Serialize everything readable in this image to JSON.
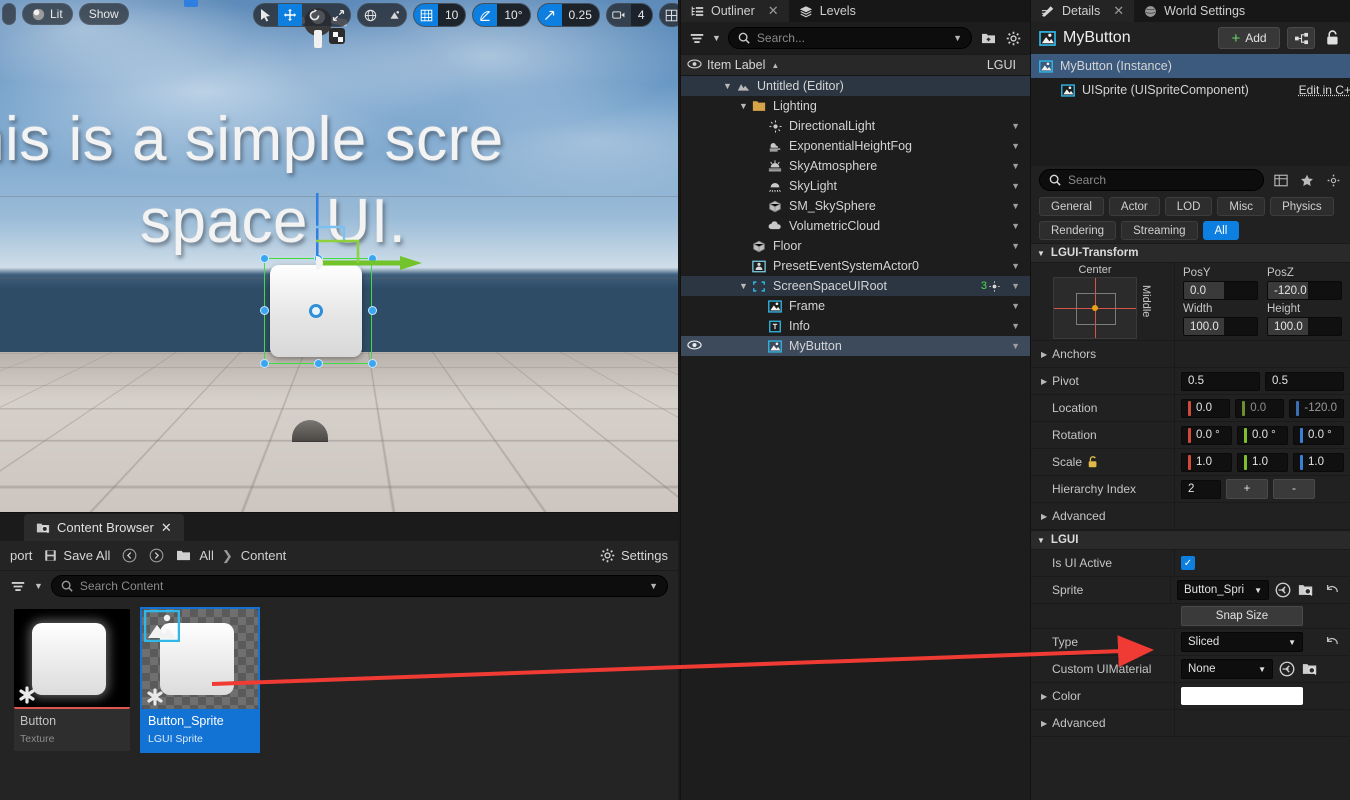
{
  "viewport": {
    "text_line1": "his is a simple scre",
    "text_line2": "space UI.",
    "view_mode": "Lit",
    "show_menu": "Show",
    "grid_snap_value": "10",
    "angle_snap_value": "10°",
    "scale_snap_value": "0.25",
    "camera_speed_value": "4",
    "icons": {
      "select": "cursor-icon",
      "translate": "move-icon",
      "rotate": "rotate-icon",
      "scale": "scale-icon",
      "world": "globe-icon",
      "surface_snap": "surface-snap-icon",
      "grid": "grid-icon",
      "angle": "angle-icon",
      "scale_snap": "scale-snap-icon",
      "camera": "camera-icon",
      "layout": "layout-icon"
    }
  },
  "content_browser": {
    "tab_label": "Content Browser",
    "import_label": "port",
    "save_all_label": "Save All",
    "breadcrumb_root": "All",
    "breadcrumb_current": "Content",
    "settings_label": "Settings",
    "search_placeholder": "Search Content",
    "assets": [
      {
        "name": "Button",
        "type": "Texture",
        "selected": false
      },
      {
        "name": "Button_Sprite",
        "type": "LGUI Sprite",
        "selected": true
      }
    ]
  },
  "outliner": {
    "tabs": [
      {
        "label": "Outliner",
        "icon": "outliner-icon",
        "active": true,
        "closable": true
      },
      {
        "label": "Levels",
        "icon": "levels-icon",
        "active": false,
        "closable": false
      }
    ],
    "search_placeholder": "Search...",
    "column_item_label": "Item Label",
    "column_sort": "▲",
    "column_type": "LGUI",
    "items": [
      {
        "label": "Untitled (Editor)",
        "indent": 1,
        "caret": "down",
        "icon": "world-icon",
        "state": "hl",
        "eye": false,
        "dropdown": false
      },
      {
        "label": "Lighting",
        "indent": 2,
        "caret": "down",
        "icon": "folder-icon",
        "state": "",
        "eye": false,
        "dropdown": false
      },
      {
        "label": "DirectionalLight",
        "indent": 3,
        "caret": "none",
        "icon": "light-icon",
        "state": "",
        "eye": false,
        "dropdown": true
      },
      {
        "label": "ExponentialHeightFog",
        "indent": 3,
        "caret": "none",
        "icon": "fog-icon",
        "state": "",
        "eye": false,
        "dropdown": true
      },
      {
        "label": "SkyAtmosphere",
        "indent": 3,
        "caret": "none",
        "icon": "atmosphere-icon",
        "state": "",
        "eye": false,
        "dropdown": true
      },
      {
        "label": "SkyLight",
        "indent": 3,
        "caret": "none",
        "icon": "skylight-icon",
        "state": "",
        "eye": false,
        "dropdown": true
      },
      {
        "label": "SM_SkySphere",
        "indent": 3,
        "caret": "none",
        "icon": "mesh-icon",
        "state": "",
        "eye": false,
        "dropdown": true
      },
      {
        "label": "VolumetricCloud",
        "indent": 3,
        "caret": "none",
        "icon": "cloud-icon",
        "state": "",
        "eye": false,
        "dropdown": true
      },
      {
        "label": "Floor",
        "indent": 2,
        "caret": "none",
        "icon": "mesh-icon",
        "state": "",
        "eye": false,
        "dropdown": true
      },
      {
        "label": "PresetEventSystemActor0",
        "indent": 2,
        "caret": "none",
        "icon": "event-icon",
        "state": "",
        "eye": false,
        "dropdown": true
      },
      {
        "label": "ScreenSpaceUIRoot",
        "indent": 2,
        "caret": "down",
        "icon": "uiroot-icon",
        "state": "hl",
        "eye": false,
        "dropdown": true,
        "badge": "3"
      },
      {
        "label": "Frame",
        "indent": 3,
        "caret": "none",
        "icon": "sprite-icon",
        "state": "",
        "eye": false,
        "dropdown": true
      },
      {
        "label": "Info",
        "indent": 3,
        "caret": "none",
        "icon": "text-icon",
        "state": "",
        "eye": false,
        "dropdown": true
      },
      {
        "label": "MyButton",
        "indent": 3,
        "caret": "none",
        "icon": "sprite-icon",
        "state": "sel",
        "eye": true,
        "dropdown": true
      }
    ]
  },
  "details": {
    "tabs": [
      {
        "label": "Details",
        "icon": "details-icon",
        "active": true,
        "closable": true
      },
      {
        "label": "World Settings",
        "icon": "globe-icon",
        "active": false,
        "closable": false
      }
    ],
    "object_name": "MyButton",
    "add_button": "Add",
    "blueprint_icon": "blueprint-icon",
    "lock_icon": "lock-icon",
    "components": [
      {
        "label": "MyButton (Instance)",
        "indent": 0,
        "selected": true,
        "icon": "sprite-icon"
      },
      {
        "label": "UISprite (UISpriteComponent)",
        "indent": 1,
        "selected": false,
        "icon": "sprite-icon",
        "link": "Edit in C++"
      }
    ],
    "search_placeholder": "Search",
    "filters": [
      "General",
      "Actor",
      "LOD",
      "Misc",
      "Physics",
      "Rendering",
      "Streaming",
      "All"
    ],
    "active_filter": "All",
    "transform": {
      "section_title": "LGUI-Transform",
      "anchor_h_label": "Center",
      "anchor_v_label": "Middle",
      "fields": [
        {
          "label": "PosY",
          "value": "0.0"
        },
        {
          "label": "PosZ",
          "value": "-120.0"
        },
        {
          "label": "Width",
          "value": "100.0"
        },
        {
          "label": "Height",
          "value": "100.0"
        }
      ],
      "anchors_label": "Anchors",
      "pivot_label": "Pivot",
      "pivot": [
        "0.5",
        "0.5"
      ],
      "location_label": "Location",
      "location": [
        "0.0",
        "0.0",
        "-120.0"
      ],
      "rotation_label": "Rotation",
      "rotation": [
        "0.0 °",
        "0.0 °",
        "0.0 °"
      ],
      "scale_label": "Scale",
      "scale": [
        "1.0",
        "1.0",
        "1.0"
      ],
      "scale_lock_icon": "unlock-icon",
      "hierarchy_index_label": "Hierarchy Index",
      "hierarchy_index": "2",
      "hierarchy_plus": "+",
      "hierarchy_minus": "-",
      "advanced_label": "Advanced"
    },
    "lgui": {
      "section_title": "LGUI",
      "is_ui_active_label": "Is UI Active",
      "is_ui_active": true,
      "sprite_label": "Sprite",
      "sprite_value": "Button_Spri",
      "snap_size_label": "Snap Size",
      "type_label": "Type",
      "type_value": "Sliced",
      "custom_material_label": "Custom UIMaterial",
      "custom_material_value": "None",
      "color_label": "Color",
      "color_value": "#ffffff",
      "advanced_label": "Advanced"
    }
  },
  "annotation": {
    "arrow_color": "#ef3b33"
  },
  "colors": {
    "accent_blue": "#0c7fe0",
    "selection": "#3c5a7d",
    "panel_bg": "#212121"
  }
}
